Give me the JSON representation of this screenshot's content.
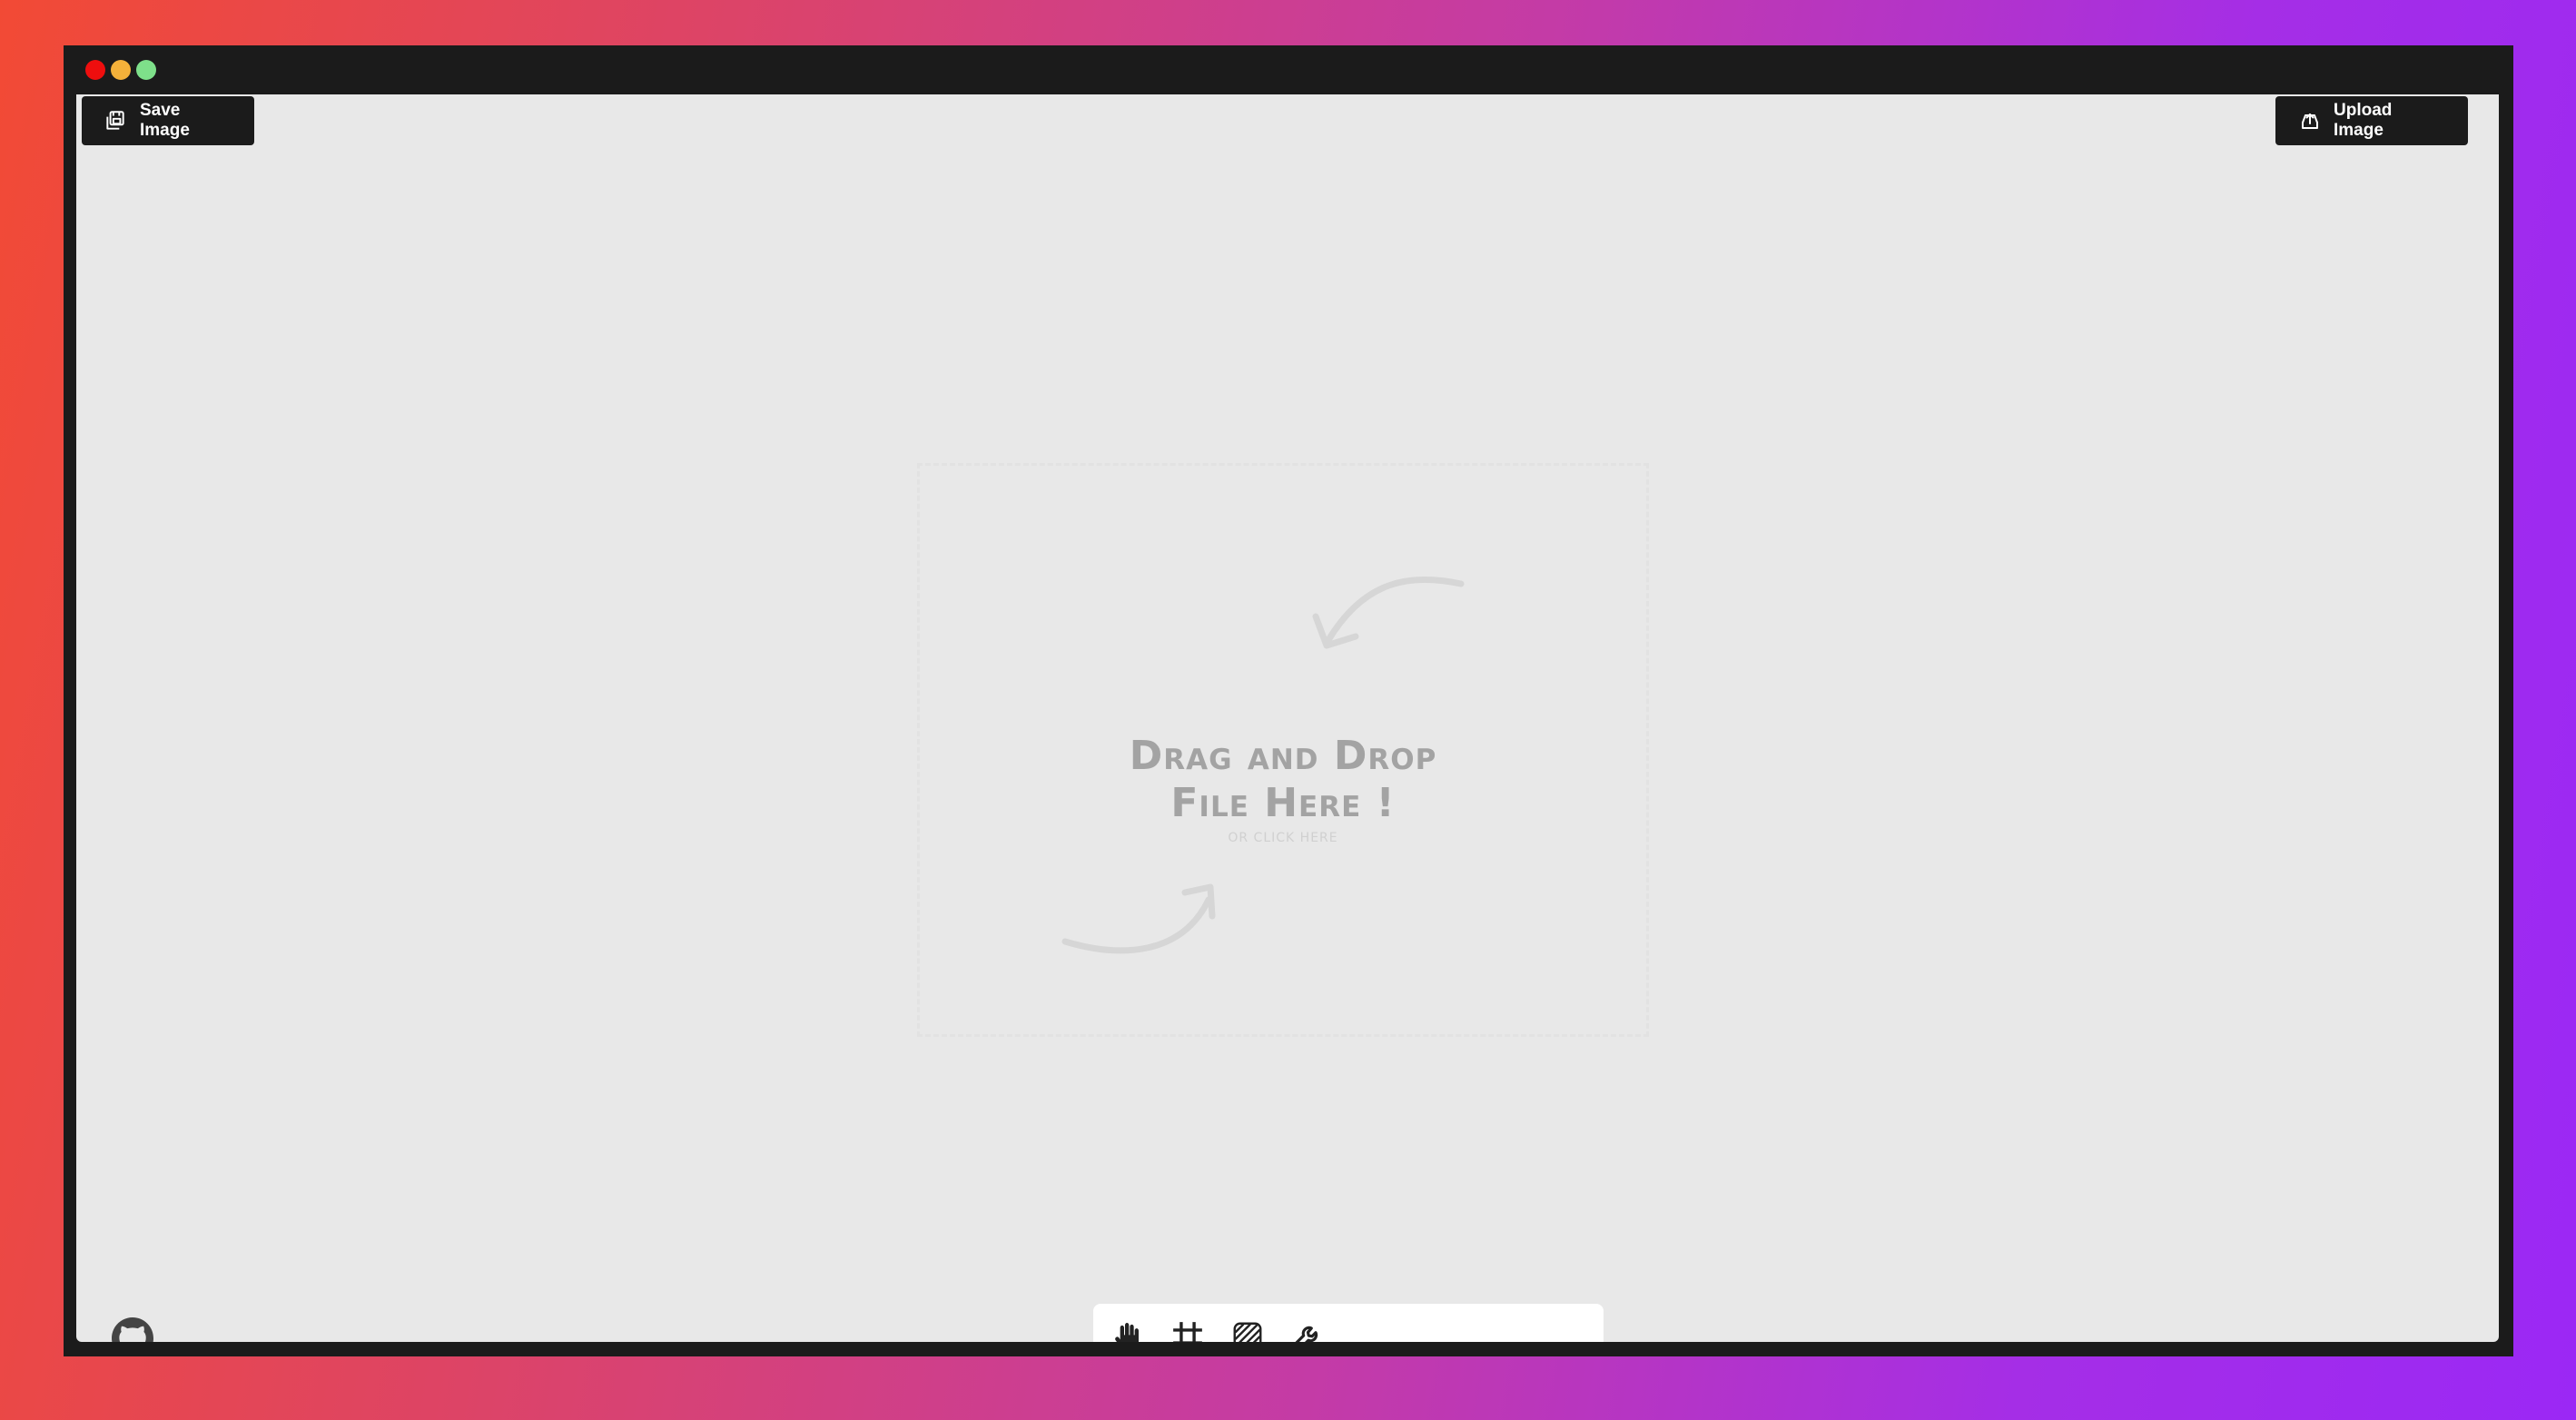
{
  "window": {
    "controls": [
      "close",
      "minimize",
      "maximize"
    ],
    "colors": {
      "close": "#ee0e0e",
      "minimize": "#f4b13a",
      "maximize": "#7ee08a"
    }
  },
  "header": {
    "save_label": "Save Image",
    "save_icon": "save-image-icon",
    "upload_label": "Upload Image",
    "upload_icon": "upload-icon"
  },
  "dropzone": {
    "title_line1": "Drag and Drop",
    "title_line2": "File Here !",
    "subtitle": "or click here"
  },
  "toolbar": {
    "tools": [
      "hand-icon",
      "crop-frame-icon",
      "pattern-icon",
      "wrench-icon"
    ]
  },
  "footer": {
    "github_icon": "github-icon"
  },
  "colors": {
    "canvas": "#e8e8e8",
    "window": "#1b1b1b",
    "button_bg": "#1b1b1b",
    "button_text": "#ffffff",
    "drop_text": "#a3a3a3"
  }
}
